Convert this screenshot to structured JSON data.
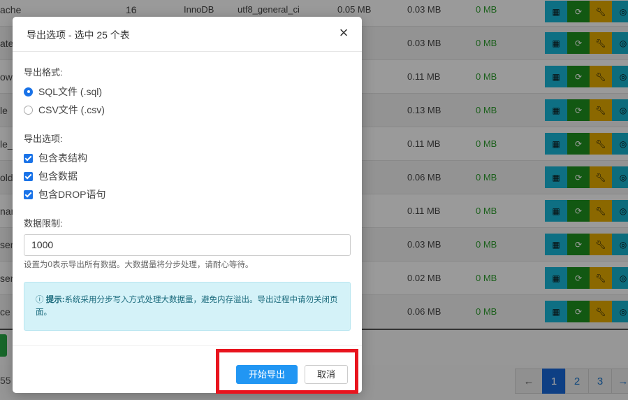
{
  "background_table": {
    "rows": [
      {
        "name": "ache",
        "rows": "16",
        "engine": "InnoDB",
        "collation": "utf8_general_ci",
        "data": "0.05 MB",
        "index": "0.03 MB",
        "free": "0 MB"
      },
      {
        "name": "ate",
        "rows": "",
        "engine": "",
        "collation": "",
        "data": "",
        "index": "0.03 MB",
        "free": "0 MB"
      },
      {
        "name": "ow",
        "rows": "",
        "engine": "",
        "collation": "",
        "data": "",
        "index": "0.11 MB",
        "free": "0 MB"
      },
      {
        "name": "le",
        "rows": "",
        "engine": "",
        "collation": "",
        "data": "",
        "index": "0.13 MB",
        "free": "0 MB"
      },
      {
        "name": "le_",
        "rows": "",
        "engine": "",
        "collation": "",
        "data": "",
        "index": "0.11 MB",
        "free": "0 MB"
      },
      {
        "name": "old",
        "rows": "",
        "engine": "",
        "collation": "",
        "data": "",
        "index": "0.06 MB",
        "free": "0 MB"
      },
      {
        "name": "nar",
        "rows": "",
        "engine": "",
        "collation": "",
        "data": "",
        "index": "0.11 MB",
        "free": "0 MB"
      },
      {
        "name": "ser",
        "rows": "",
        "engine": "",
        "collation": "",
        "data": "",
        "index": "0.03 MB",
        "free": "0 MB"
      },
      {
        "name": "ser",
        "rows": "",
        "engine": "",
        "collation": "",
        "data": "",
        "index": "0.02 MB",
        "free": "0 MB"
      },
      {
        "name": "ce",
        "rows": "",
        "engine": "",
        "collation": "",
        "data": "",
        "index": "0.06 MB",
        "free": "0 MB"
      }
    ],
    "action_icons": [
      "table-icon",
      "refresh-icon",
      "wrench-icon",
      "eye-icon"
    ],
    "count_text": "55",
    "pagination": [
      "←",
      "1",
      "2",
      "3",
      "→"
    ],
    "active_page": "1"
  },
  "modal": {
    "title": "导出选项 - 选中 25 个表",
    "close_label": "×",
    "format_label": "导出格式:",
    "format_options": [
      {
        "label": "SQL文件 (.sql)",
        "checked": true
      },
      {
        "label": "CSV文件 (.csv)",
        "checked": false
      }
    ],
    "options_label": "导出选项:",
    "options": [
      {
        "label": "包含表结构",
        "checked": true
      },
      {
        "label": "包含数据",
        "checked": true
      },
      {
        "label": "包含DROP语句",
        "checked": true
      }
    ],
    "limit_label": "数据限制:",
    "limit_value": "1000",
    "limit_help": "设置为0表示导出所有数据。大数据量将分步处理，请耐心等待。",
    "alert_icon": "ⓘ",
    "alert_title": "提示:",
    "alert_text": "系统采用分步写入方式处理大数据量，避免内存溢出。导出过程中请勿关闭页面。",
    "start_button": "开始导出",
    "cancel_button": "取消"
  },
  "colors": {
    "primary": "#2196f3",
    "highlight": "#e8141e",
    "alert_bg": "#d4f2f8",
    "free_text": "#2e9b2e"
  }
}
